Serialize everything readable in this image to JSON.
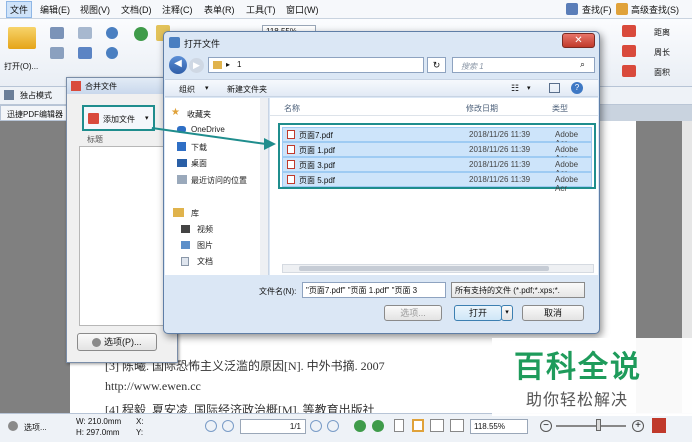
{
  "menubar": {
    "items": [
      "文件",
      "编辑(E)",
      "视图(V)",
      "文档(D)",
      "注释(C)",
      "表单(R)",
      "工具(T)",
      "窗口(W)"
    ],
    "right": [
      "查找(F)",
      "高级查找(S)"
    ]
  },
  "ribbon": {
    "open_label": "打开(O)...",
    "zoom_value": "118.55%",
    "right_labels": [
      "距离",
      "周长",
      "面积"
    ]
  },
  "subbar": {
    "tab_label": "独占模式",
    "doc_tab_label": "迅捷PDF编辑器"
  },
  "merge_dialog": {
    "title": "合并文件",
    "add_button": "添加文件",
    "column_header": "标题",
    "options_button": "选项(P)..."
  },
  "open_dialog": {
    "title": "打开文件",
    "path": "1",
    "search_placeholder": "搜索 1",
    "organize": "组织",
    "new_folder": "新建文件夹",
    "columns": {
      "name": "名称",
      "date": "修改日期",
      "type": "类型"
    },
    "files": [
      {
        "name": "页面7.pdf",
        "date": "2018/11/26 11:39",
        "type": "Adobe Acr"
      },
      {
        "name": "页面 1.pdf",
        "date": "2018/11/26 11:39",
        "type": "Adobe Acr"
      },
      {
        "name": "页面 3.pdf",
        "date": "2018/11/26 11:39",
        "type": "Adobe Acr"
      },
      {
        "name": "页面 5.pdf",
        "date": "2018/11/26 11:39",
        "type": "Adobe Acr"
      }
    ],
    "nav": {
      "favorites": "收藏夹",
      "fav_items": [
        "OneDrive",
        "下载",
        "桌面",
        "最近访问的位置"
      ],
      "library": "库",
      "lib_items": [
        "视频",
        "图片",
        "文档"
      ]
    },
    "filename_label": "文件名(N):",
    "filename_value": "\"页面7.pdf\" \"页面 1.pdf\" \"页面 3",
    "filetype_value": "所有支持的文件 (*.pdf;*.xps;*.",
    "options_button": "选项...",
    "open_button": "打开",
    "cancel_button": "取消"
  },
  "document": {
    "line1": "[3] 陈曦. 国际恐怖主义泛滥的原因[N]. 中外书摘. 2007",
    "line2": "http://www.ewen.cc",
    "line3": "[4] 程毅, 夏安凌. 国际经济政治概[M]. 等教育出版社"
  },
  "statusbar": {
    "options": "选项...",
    "width": "W: 210.0mm",
    "height": "H: 297.0mm",
    "x": "X:",
    "y": "Y:",
    "page": "1/1",
    "zoom": "118.55%"
  },
  "watermark": {
    "title": "百科全说",
    "subtitle": "助你轻松解决"
  },
  "colors": {
    "accent": "#1f8d8d",
    "watermark_green": "#1e9b5b"
  }
}
